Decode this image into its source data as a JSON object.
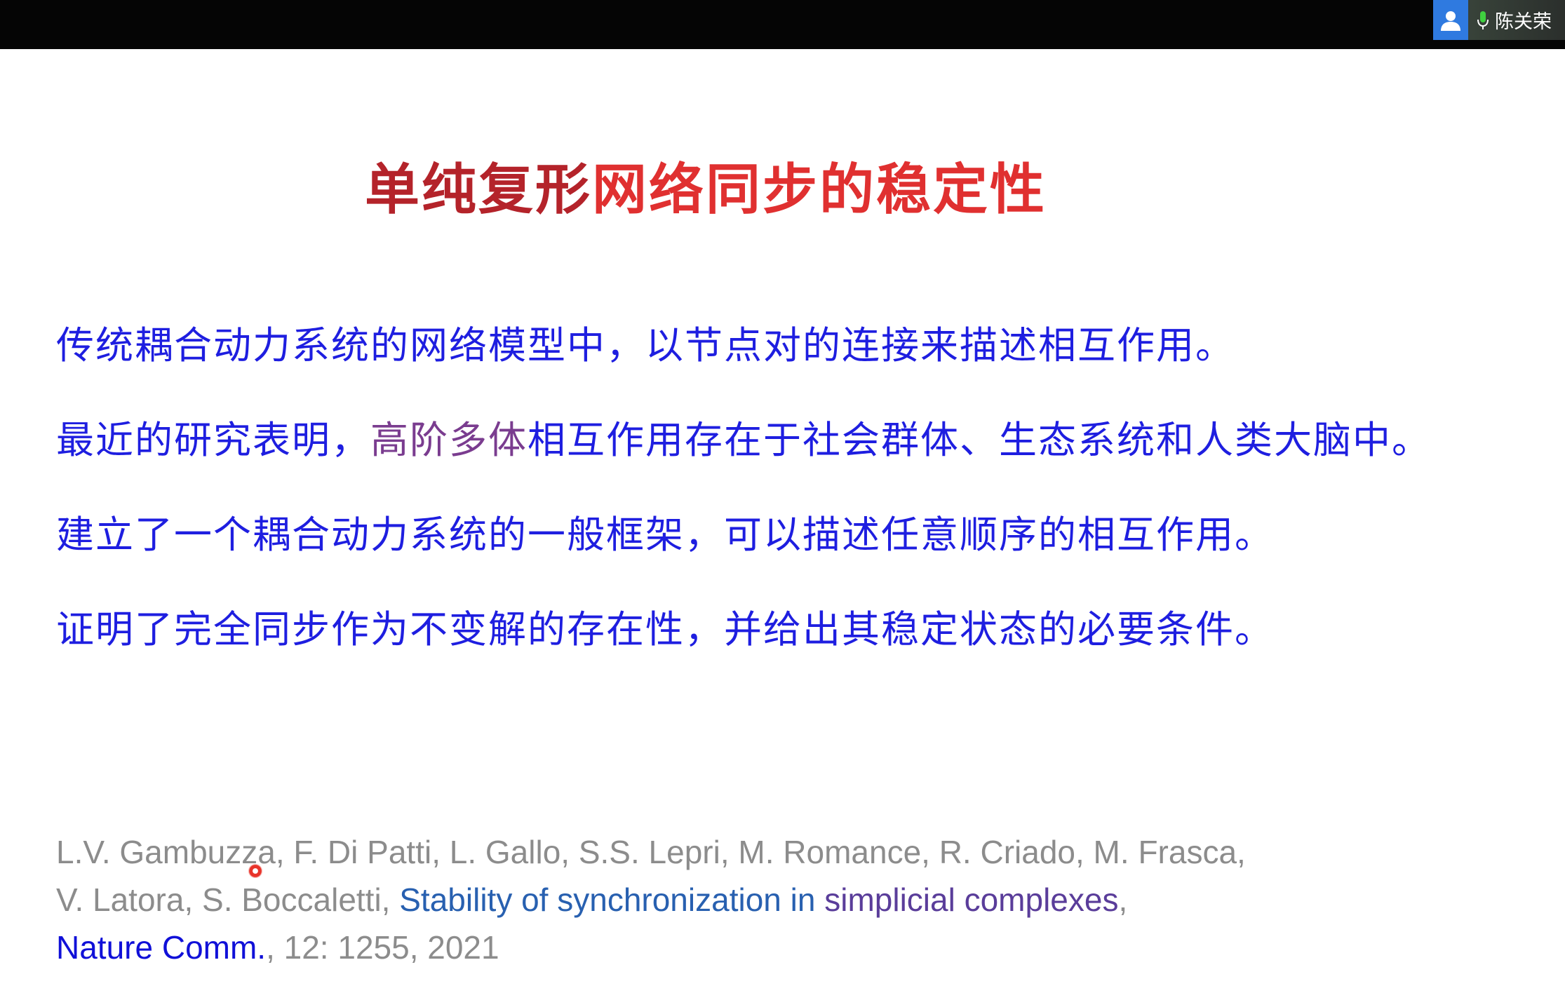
{
  "meeting": {
    "participant_name": "陈关荣",
    "avatar_icon": "user-icon",
    "mic_icon": "microphone-icon",
    "accent": "#2f7ae0"
  },
  "slide": {
    "title_part1": "单纯复形",
    "title_part2": "网络同步的稳定性",
    "bullets": [
      {
        "text": "传统耦合动力系统的网络模型中，以节点对的连接来描述相互作用。"
      },
      {
        "before": "最近的研究表明，",
        "highlight": "高阶多体",
        "after": "相互作用存在于社会群体、生态系统和人类大脑中。"
      },
      {
        "text": "建立了一个耦合动力系统的一般框架，可以描述任意顺序的相互作用。"
      },
      {
        "text": "证明了完全同步作为不变解的存在性，并给出其稳定状态的必要条件。"
      }
    ],
    "reference": {
      "line1": "L.V. Gambuzza, F. Di Patti, L. Gallo, S.S. Lepri, M. Romance, R. Criado, M. Frasca,",
      "line2_authors": "V. Latora, S. Boccaletti, ",
      "line2_title_a": "Stability of synchronization in ",
      "line2_title_b": "simplicial complexes",
      "line2_comma": ",",
      "line3_journal": "Nature Comm.",
      "line3_rest": ", 12: 1255, 2021"
    },
    "colors": {
      "title_dark": "#b4232a",
      "title_red": "#e03030",
      "bullet_blue": "#1e1ee0",
      "highlight_purple": "#7a3c8f",
      "reference_gray": "#8c8c8c"
    }
  }
}
